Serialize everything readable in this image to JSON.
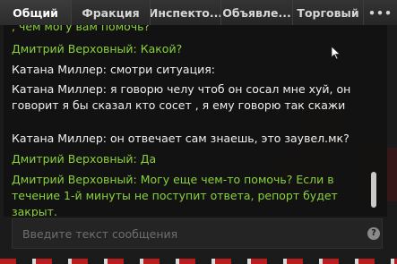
{
  "tabs": [
    {
      "label": "Общий"
    },
    {
      "label": "Фракция"
    },
    {
      "label": "Инспекто..."
    },
    {
      "label": "Объявле..."
    },
    {
      "label": "Торговый"
    },
    {
      "label": "•••"
    }
  ],
  "chat": {
    "messages": [
      {
        "author": "",
        "text": ", чем могу вам помочь?",
        "color": "green"
      },
      {
        "author": "Дмитрий Верховный",
        "text": "Дмитрий Верховный: Какой?",
        "color": "green"
      },
      {
        "author": "Катана Миллер",
        "text": "Катана Миллер: смотри ситуация:",
        "color": "white"
      },
      {
        "author": "Катана Миллер",
        "text": "Катана Миллер: я говорю челу чтоб он сосал мне хуй, он говорит я бы сказал кто сосет , я ему говорю так скажи",
        "color": "white"
      },
      {
        "author": "Катана Миллер",
        "text": "Катана Миллер: он отвечает сам знаешь, это заувел.мк?",
        "color": "white"
      },
      {
        "author": "Дмитрий Верховный",
        "text": "Дмитрий Верховный: Да",
        "color": "green"
      },
      {
        "author": "Дмитрий Верховный",
        "text": "Дмитрий Верховный: Могу еще чем-то помочь? Если в течение 1-й минуты не поступит ответа, репорт будет закрыт.",
        "color": "green"
      }
    ]
  },
  "input": {
    "placeholder": "Введите текст сообщения",
    "value": ""
  },
  "help": {
    "icon": "help-icon",
    "glyph": "?"
  },
  "colors": {
    "admin_text": "#8ad13a",
    "player_text": "#f0f0f0",
    "panel_bg": "#111111",
    "tab_bg": "#2b2b2b"
  }
}
